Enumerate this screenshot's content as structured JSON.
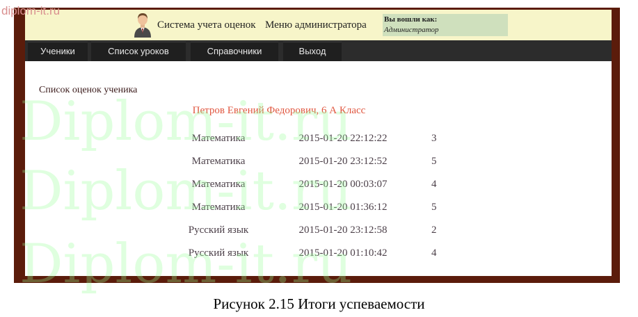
{
  "corner_watermark": "diplom-it.ru",
  "header": {
    "app_title": "Система учета оценок",
    "admin_menu": "Меню администратора",
    "login_label": "Вы вошли как:",
    "login_user": "Администратор"
  },
  "nav": {
    "items": [
      {
        "label": "Ученики"
      },
      {
        "label": "Список уроков"
      },
      {
        "label": "Справочники"
      },
      {
        "label": "Выход"
      }
    ]
  },
  "main": {
    "section_title": "Список оценок ученика",
    "student_name": "Петров Евгений Федорович, 6 А Класс",
    "grades": [
      {
        "subject": "Математика",
        "datetime": "2015-01-20 22:12:22",
        "grade": "3"
      },
      {
        "subject": "Математика",
        "datetime": "2015-01-20 23:12:52",
        "grade": "5"
      },
      {
        "subject": "Математика",
        "datetime": "2015-01-20 00:03:07",
        "grade": "4"
      },
      {
        "subject": "Математика",
        "datetime": "2015-01-20 01:36:12",
        "grade": "5"
      },
      {
        "subject": "Русский язык",
        "datetime": "2015-01-20 23:12:58",
        "grade": "2"
      },
      {
        "subject": "Русский язык",
        "datetime": "2015-01-20 01:10:42",
        "grade": "4"
      }
    ]
  },
  "caption": "Рисунок 2.15 Итоги успеваемости",
  "watermark_text": "Diplom-it.ru",
  "colors": {
    "frame": "#5b1c0b",
    "header_bg": "#f7f5c9",
    "login_bg": "#cfe0bd",
    "nav_bg": "#2c2c2c",
    "student_name": "#e0563f"
  }
}
